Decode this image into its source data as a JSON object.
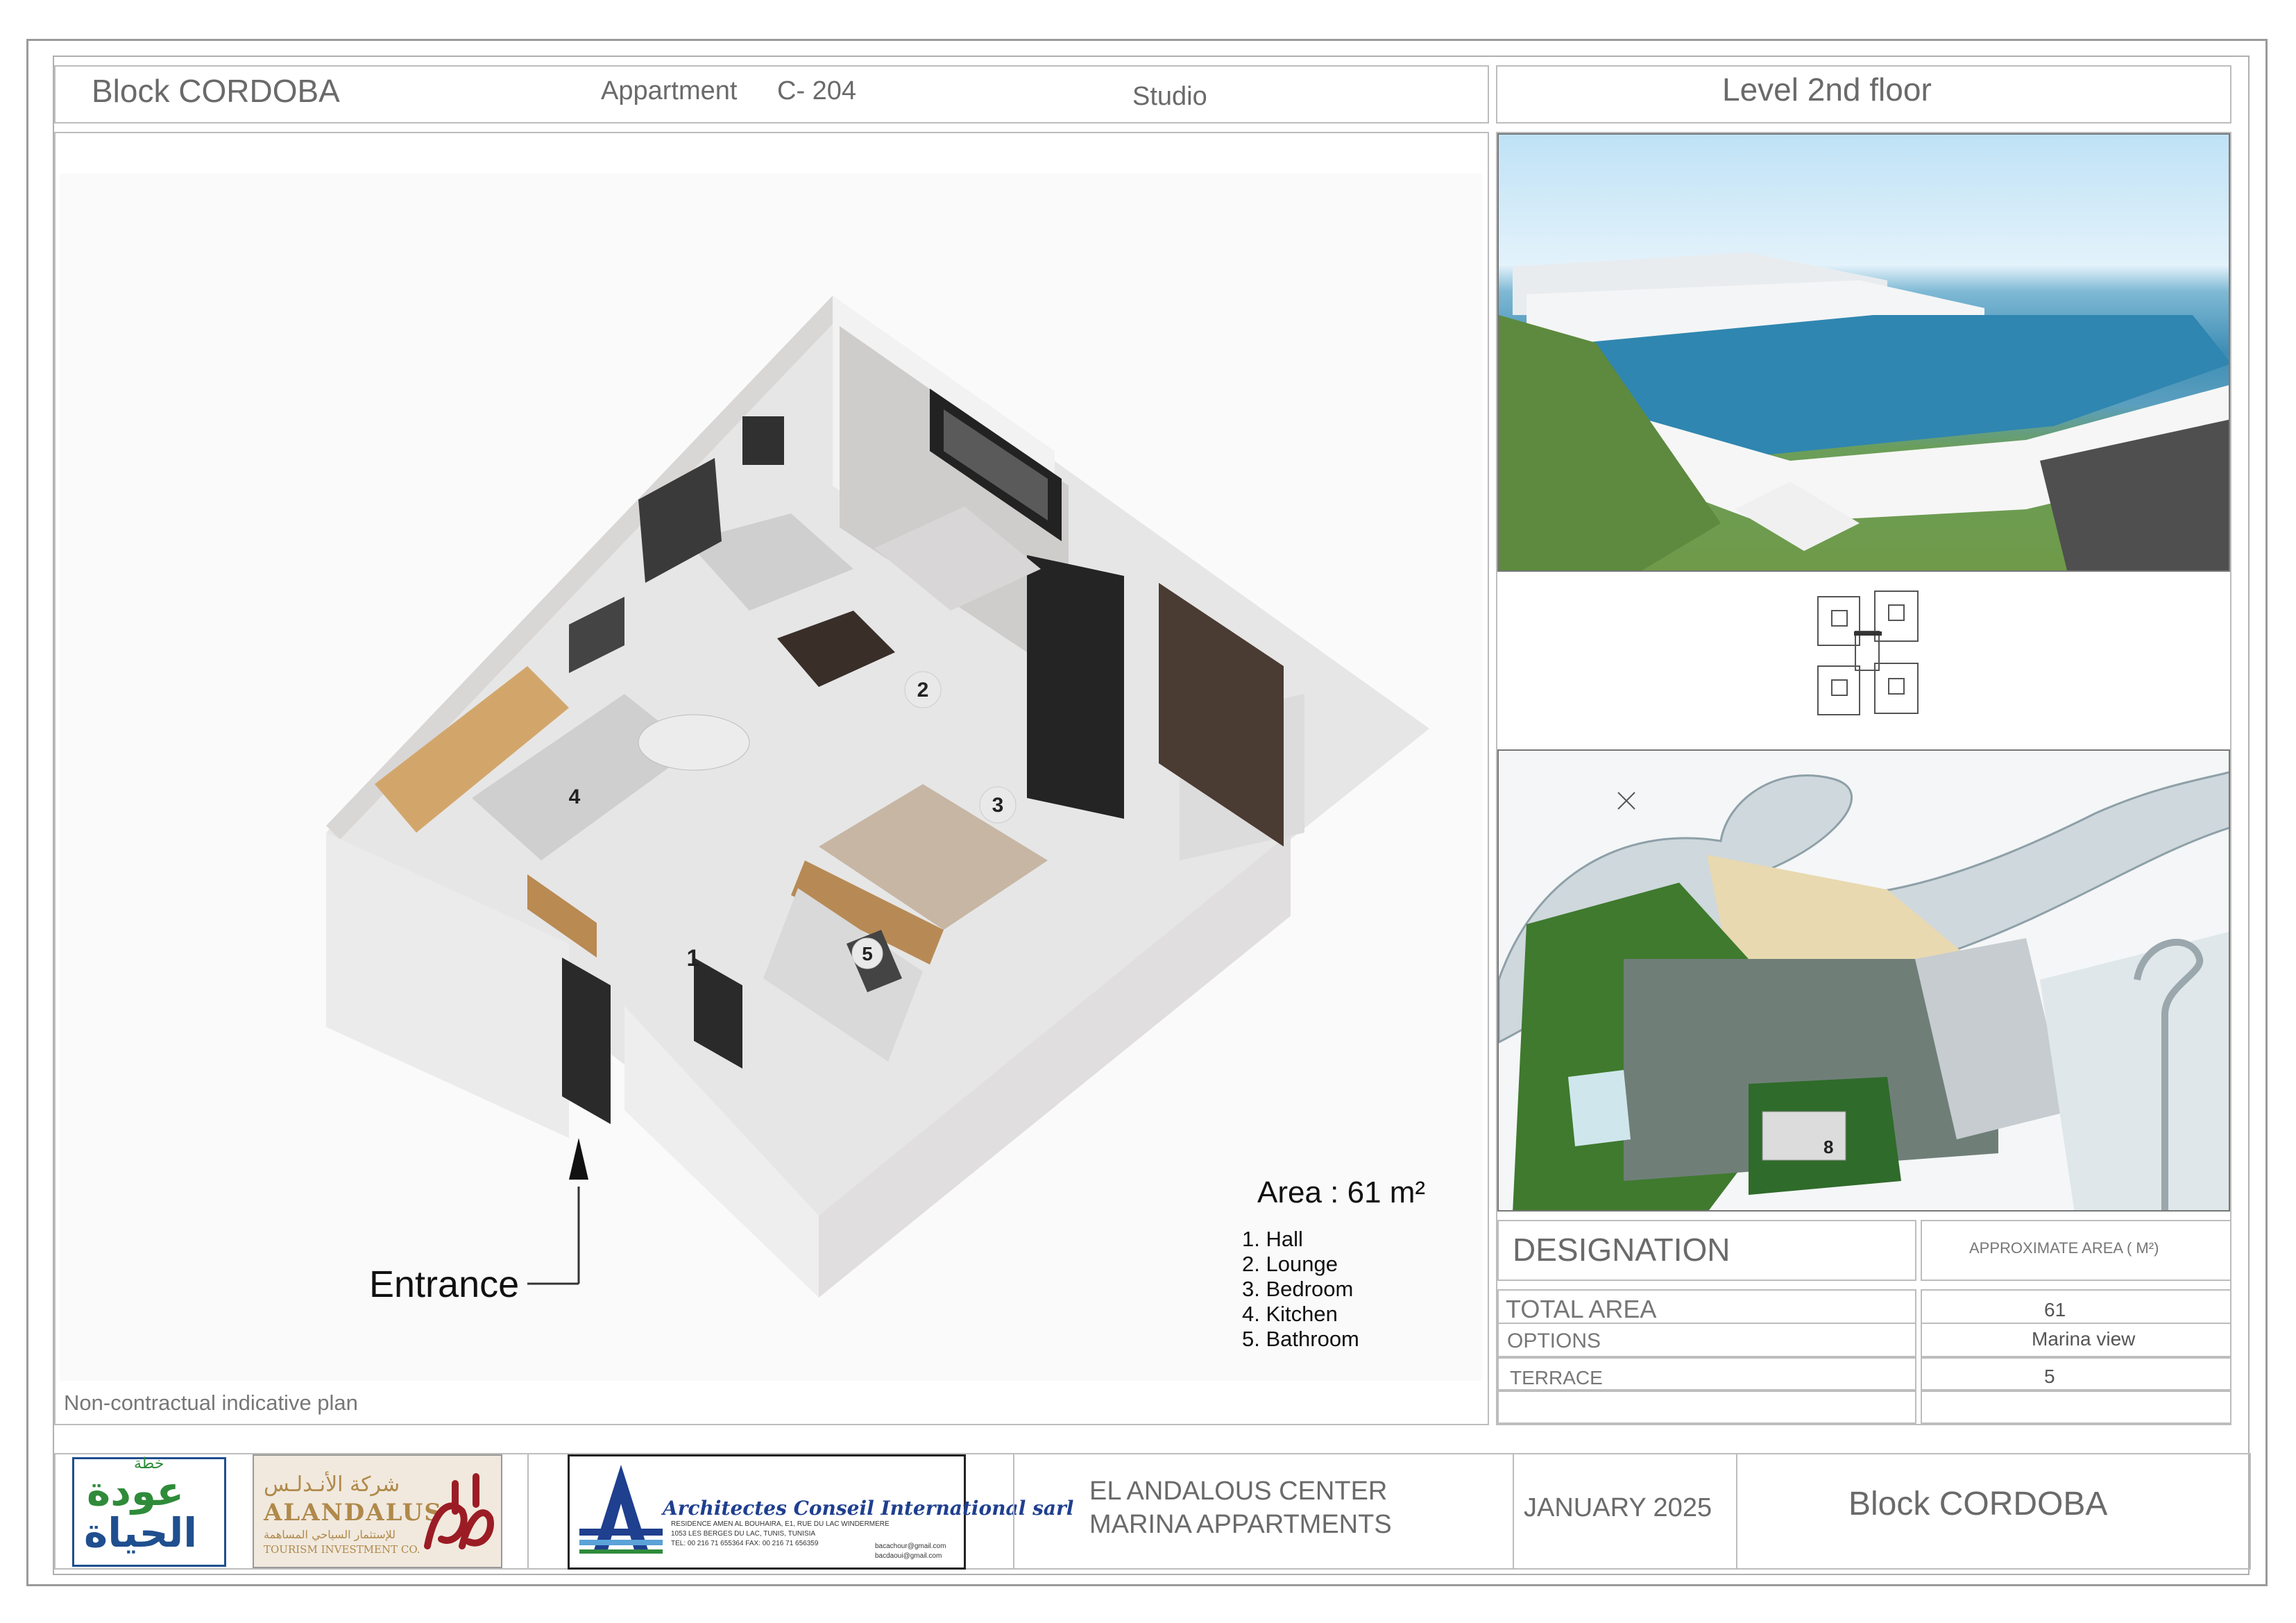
{
  "header": {
    "block": "Block CORDOBA",
    "apartment_label": "Appartment",
    "apartment_code": "C- 204",
    "type": "Studio",
    "level": "Level 2nd  floor"
  },
  "plan": {
    "area_label": "Area : 61 m²",
    "entrance_label": "Entrance",
    "disclaimer": "Non-contractual indicative plan",
    "rooms": [
      {
        "num": "1",
        "name": "Hall"
      },
      {
        "num": "2",
        "name": "Lounge"
      },
      {
        "num": "3",
        "name": "Bedroom"
      },
      {
        "num": "4",
        "name": "Kitchen"
      },
      {
        "num": "5",
        "name": "Bathroom"
      }
    ],
    "legend": [
      "Hall",
      "Lounge",
      "Bedroom",
      "Kitchen",
      "Bathroom"
    ]
  },
  "table": {
    "designation": "DESIGNATION",
    "approx_area": "APPROXIMATE AREA  ( M²)",
    "rows": [
      {
        "label": "TOTAL AREA",
        "value": "61"
      },
      {
        "label": "OPTIONS",
        "value": "Marina view"
      },
      {
        "label": "TERRACE",
        "value": "5"
      }
    ]
  },
  "sitemap": {
    "marker": "8"
  },
  "footer": {
    "logo1_top": "خطة",
    "logo1_line1": "عودة",
    "logo1_line2": "الحياة",
    "logo2_arabic": "شركة الأنـدلـس",
    "logo2_name": "ALANDALUS",
    "logo2_sub_ar": "للإستثمار السياحي المساهمة",
    "logo2_sub": "TOURISM INVESTMENT CO.",
    "architect_name": "Architectes  Conseil  International sarl",
    "architect_addr1": "RESIDENCE  AMEN AL BOUHAIRA, E1, RUE DU LAC WINDERMERE",
    "architect_addr2": "1053 LES BERGES DU LAC, TUNIS, TUNISIA",
    "architect_tel": "TEL: 00 216 71 655364   FAX: 00 216 71 656359",
    "architect_email1": "bacachour@gmail.com",
    "architect_email2": "bacdaoui@gmail.com",
    "project_line1": "EL ANDALOUS CENTER",
    "project_line2": "MARINA APPARTMENTS",
    "date": "JANUARY  2025",
    "block": "Block  CORDOBA"
  },
  "colors": {
    "logo_green": "#2f8b3a",
    "logo_blue": "#1f4f8f",
    "logo2_red": "#9b1c25",
    "logo2_gold": "#b0894a",
    "architect_blue": "#1f3f8f"
  }
}
